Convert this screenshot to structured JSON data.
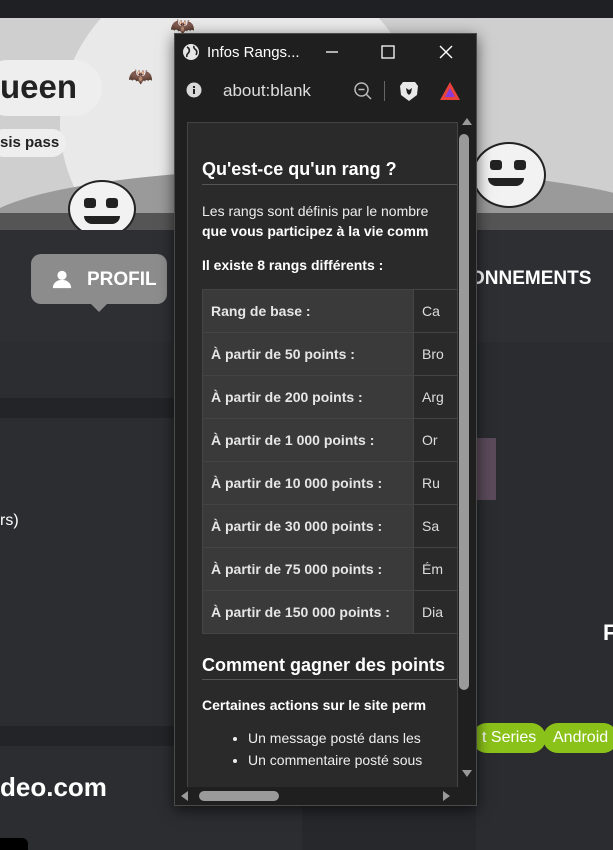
{
  "page": {
    "user_name": "ueen",
    "subtitle": "sis pass",
    "nav_profil": "PROFIL",
    "nav_abonnements": "ONNEMENTS",
    "left_text": "rs)",
    "left_site": "deo.com",
    "right_letter": "F",
    "tags": [
      "t Series",
      "Android"
    ]
  },
  "popup": {
    "window_title": "Infos Rangs...",
    "url": "about:blank",
    "content": {
      "heading_rang": "Qu'est-ce qu'un rang ?",
      "para1": "Les rangs sont définis par le nombre",
      "para1_bold": "que vous participez à la vie comm",
      "para2": "Il existe 8 rangs différents :",
      "ranks": [
        {
          "threshold": "Rang de base :",
          "name": "Ca"
        },
        {
          "threshold": "À partir de 50 points :",
          "name": "Bro"
        },
        {
          "threshold": "À partir de 200 points :",
          "name": "Arg"
        },
        {
          "threshold": "À partir de 1 000 points :",
          "name": "Or"
        },
        {
          "threshold": "À partir de 10 000 points :",
          "name": "Ru"
        },
        {
          "threshold": "À partir de 30 000 points :",
          "name": "Sa"
        },
        {
          "threshold": "À partir de 75 000 points :",
          "name": "Ém"
        },
        {
          "threshold": "À partir de 150 000 points :",
          "name": "Dia"
        }
      ],
      "heading_points": "Comment gagner des points",
      "para3": "Certaines actions sur le site perm",
      "bullets": [
        "Un message posté dans les",
        "Un commentaire posté sous"
      ]
    }
  },
  "colors": {
    "tag_green": "#8bc21a",
    "profil_button": "#8c8c8c",
    "rewards_triangle": "#e8423a"
  }
}
